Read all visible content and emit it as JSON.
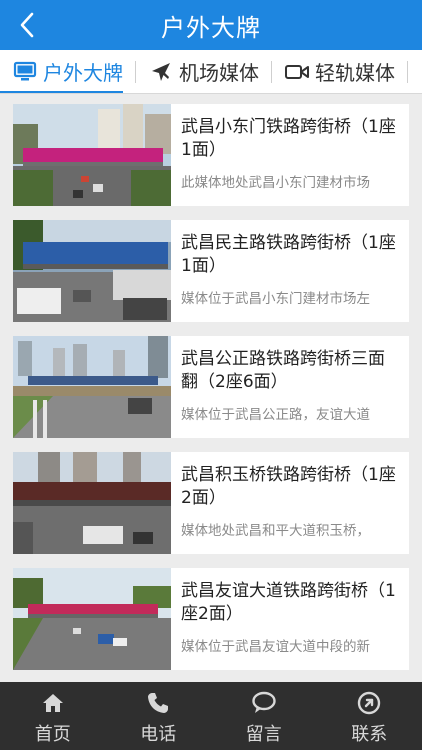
{
  "header": {
    "title": "户外大牌"
  },
  "tabs": [
    {
      "label": "户外大牌",
      "icon": "billboard-icon",
      "active": true
    },
    {
      "label": "机场媒体",
      "icon": "airplane-icon"
    },
    {
      "label": "轻轨媒体",
      "icon": "video-camera-icon"
    }
  ],
  "items": [
    {
      "title": "武昌小东门铁路跨街桥（1座1面）",
      "desc": "此媒体地处武昌小东门建材市场"
    },
    {
      "title": "武昌民主路铁路跨街桥（1座1面）",
      "desc": "媒体位于武昌小东门建材市场左"
    },
    {
      "title": "武昌公正路铁路跨街桥三面翻（2座6面）",
      "desc": "媒体位于武昌公正路，友谊大道"
    },
    {
      "title": "武昌积玉桥铁路跨街桥（1座2面）",
      "desc": "媒体地处武昌和平大道积玉桥，"
    },
    {
      "title": "武昌友谊大道铁路跨街桥（1座2面）",
      "desc": "媒体位于武昌友谊大道中段的新"
    }
  ],
  "tabbar": [
    {
      "label": "首页",
      "icon": "home-icon"
    },
    {
      "label": "电话",
      "icon": "phone-icon"
    },
    {
      "label": "留言",
      "icon": "message-icon"
    },
    {
      "label": "联系",
      "icon": "contact-icon"
    }
  ],
  "colors": {
    "accent": "#1e86e0",
    "tabbar_bg": "#2f2f2f"
  }
}
